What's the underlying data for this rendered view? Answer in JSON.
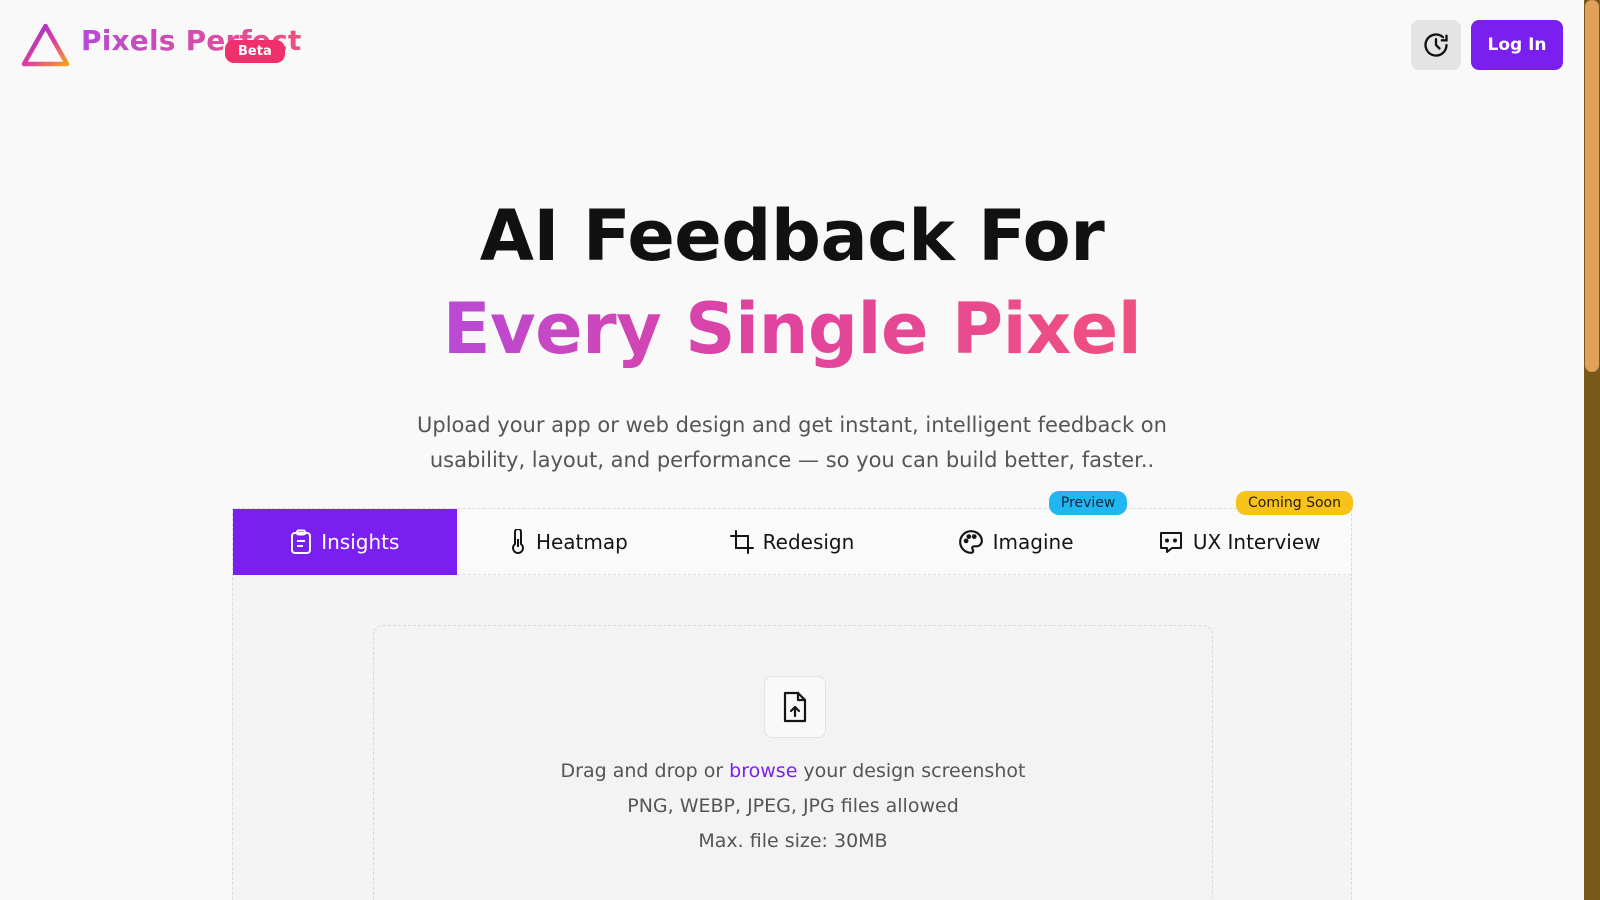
{
  "header": {
    "brand": "Pixels Perfect",
    "badge": "Beta",
    "history_icon": "clock-history-icon",
    "login_label": "Log In"
  },
  "hero": {
    "title_line1": "AI Feedback For",
    "title_line2": "Every Single Pixel",
    "subtitle": "Upload your app or web design and get instant, intelligent feedback on usability, layout, and performance — so you can build better, faster.."
  },
  "tabs": [
    {
      "label": "Insights",
      "icon": "clipboard-icon",
      "active": true
    },
    {
      "label": "Heatmap",
      "icon": "thermometer-icon"
    },
    {
      "label": "Redesign",
      "icon": "crop-icon"
    },
    {
      "label": "Imagine",
      "icon": "palette-icon",
      "badge": "Preview"
    },
    {
      "label": "UX Interview",
      "icon": "chat-icon",
      "badge": "Coming Soon"
    }
  ],
  "dropzone": {
    "icon": "file-upload-icon",
    "prefix": "Drag and drop or ",
    "browse_label": "browse",
    "suffix": " your design screenshot",
    "formats": "PNG, WEBP, JPEG, JPG files allowed",
    "max_size": "Max. file size: 30MB"
  },
  "colors": {
    "accent": "#7b1ff0",
    "beta_badge": "#f0306d",
    "preview_badge": "#1fb6f2",
    "soon_badge": "#f7c21a",
    "gradient_start": "#b84ad6",
    "gradient_end": "#f0507f"
  }
}
